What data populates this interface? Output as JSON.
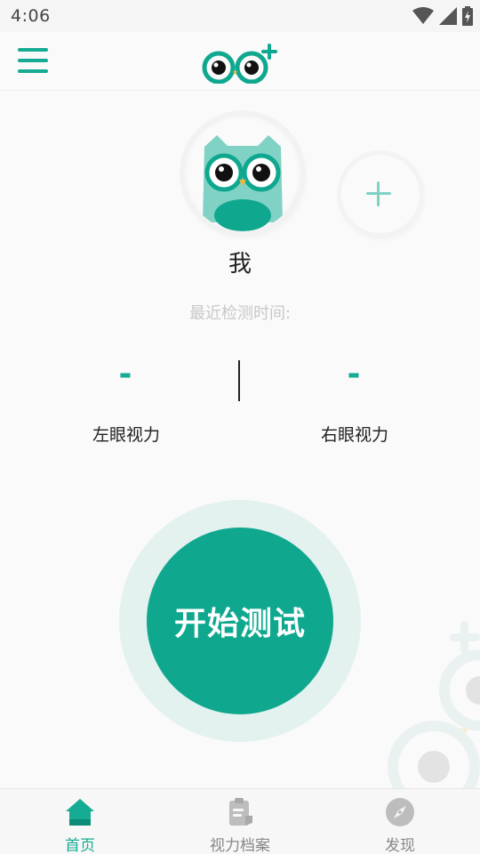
{
  "status_bar": {
    "time": "4:06",
    "icons": [
      "wifi-icon",
      "signal-icon",
      "battery-charging-icon"
    ]
  },
  "app_bar": {
    "menu_icon": "hamburger-menu-icon",
    "logo_icon": "owl-eyes-plus-logo"
  },
  "profile": {
    "name": "我",
    "avatar_icon": "owl-avatar",
    "add_icon": "plus-icon"
  },
  "last_test": {
    "label": "最近检测时间:"
  },
  "vision": {
    "left_value": "-",
    "left_label": "左眼视力",
    "right_value": "-",
    "right_label": "右眼视力"
  },
  "start_button": {
    "label": "开始测试"
  },
  "bottom_nav": {
    "items": [
      {
        "label": "首页",
        "icon": "home-icon",
        "active": true
      },
      {
        "label": "视力档案",
        "icon": "clipboard-icon",
        "active": false
      },
      {
        "label": "发现",
        "icon": "compass-icon",
        "active": false
      }
    ]
  },
  "colors": {
    "primary": "#0fa88f",
    "accent_text": "#16ab93",
    "ring": "#e3f1ef",
    "inactive": "#888888"
  }
}
